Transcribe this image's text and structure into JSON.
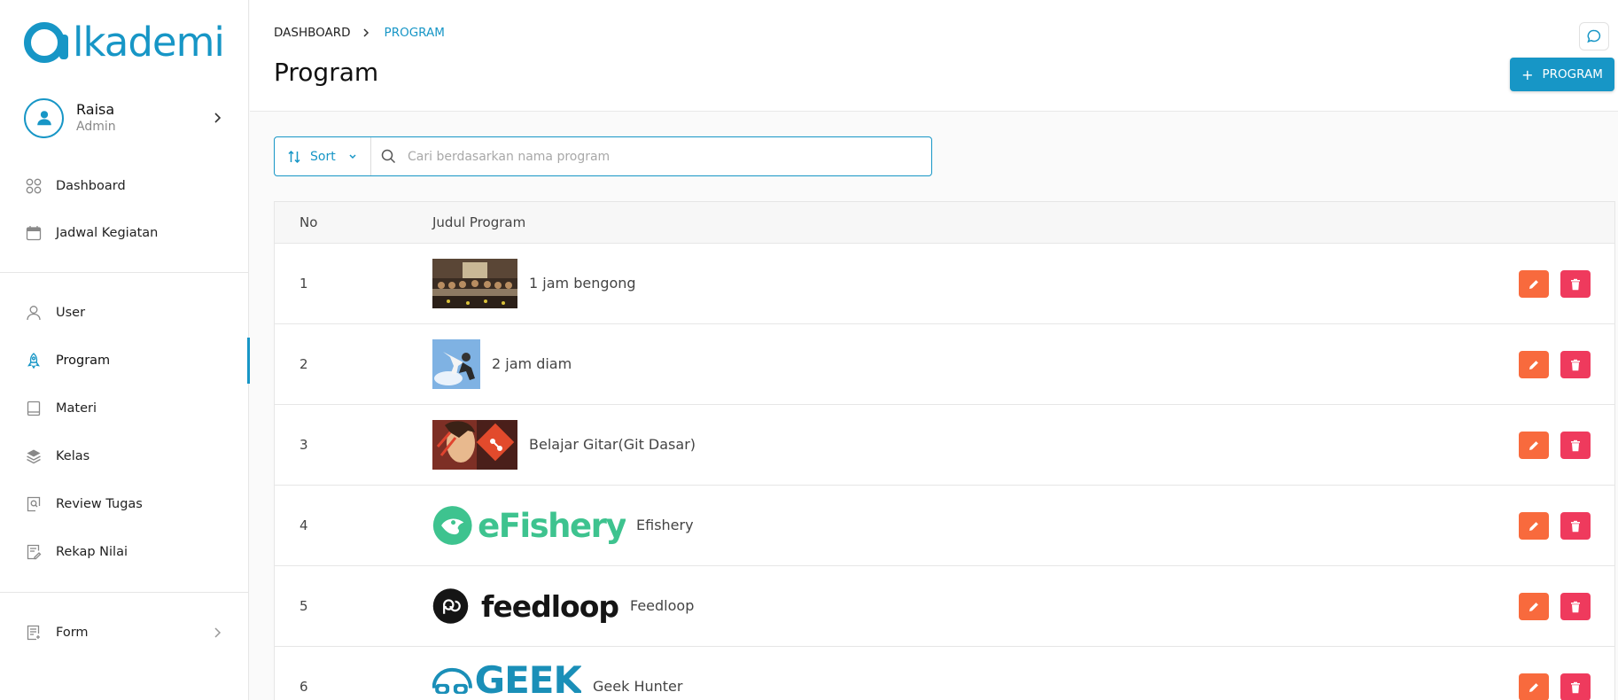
{
  "brand": {
    "logo_text": "lkademi",
    "color": "#1796c6"
  },
  "profile": {
    "name": "Raisa",
    "role": "Admin"
  },
  "sidebar": {
    "items": [
      {
        "label": "Dashboard",
        "icon": "dashboard-icon"
      },
      {
        "label": "Jadwal Kegiatan",
        "icon": "calendar-icon"
      },
      {
        "label": "User",
        "icon": "user-icon"
      },
      {
        "label": "Program",
        "icon": "rocket-icon",
        "active": true
      },
      {
        "label": "Materi",
        "icon": "book-icon"
      },
      {
        "label": "Kelas",
        "icon": "layers-icon"
      },
      {
        "label": "Review Tugas",
        "icon": "review-icon"
      },
      {
        "label": "Rekap Nilai",
        "icon": "edit-list-icon"
      },
      {
        "label": "Form",
        "icon": "form-icon"
      }
    ]
  },
  "header": {
    "breadcrumb": [
      "DASHBOARD",
      "PROGRAM"
    ],
    "title": "Program",
    "add_button": "PROGRAM"
  },
  "filter": {
    "sort_label": "Sort",
    "search_placeholder": "Cari berdasarkan nama program"
  },
  "table": {
    "columns": [
      "No",
      "Judul Program"
    ],
    "rows": [
      {
        "no": "1",
        "title": "1 jam bengong"
      },
      {
        "no": "2",
        "title": "2 jam diam"
      },
      {
        "no": "3",
        "title": "Belajar Gitar(Git Dasar)"
      },
      {
        "no": "4",
        "title": "Efishery",
        "logo_text": "eFishery"
      },
      {
        "no": "5",
        "title": "Feedloop",
        "logo_text": "feedloop"
      },
      {
        "no": "6",
        "title": "Geek Hunter",
        "logo_text": "GEEK"
      }
    ]
  },
  "colors": {
    "accent": "#1796c6",
    "edit": "#f86a3d",
    "delete": "#ef3a5d"
  }
}
